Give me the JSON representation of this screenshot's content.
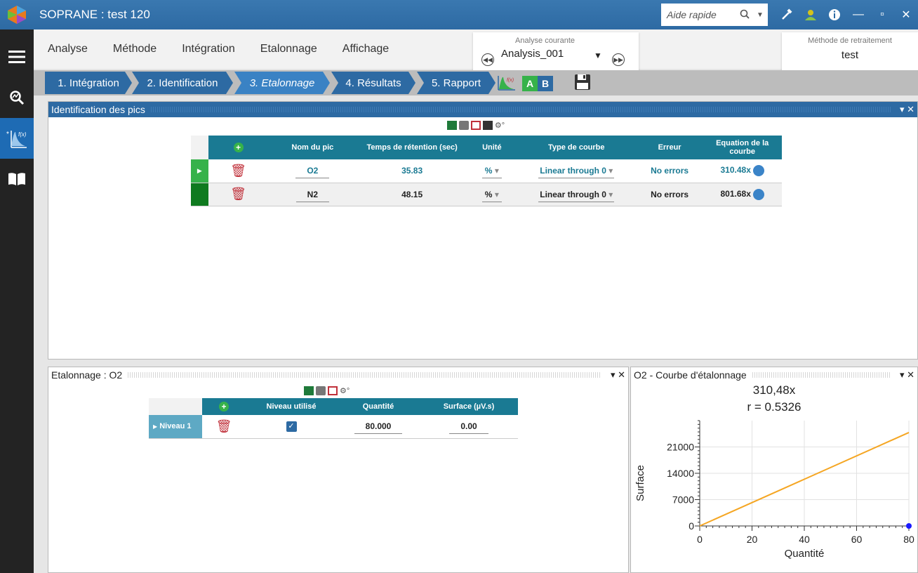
{
  "title_bar": {
    "app_title": "SOPRANE : test 120",
    "help_placeholder": "Aide rapide",
    "icons": [
      "search-icon",
      "hammer-icon",
      "user-icon",
      "info-icon",
      "minimize-icon",
      "maximize-icon",
      "close-icon"
    ]
  },
  "menu": {
    "items": [
      "Analyse",
      "Méthode",
      "Intégration",
      "Etalonnage",
      "Affichage"
    ]
  },
  "current_analysis": {
    "label": "Analyse courante",
    "value": "Analysis_001"
  },
  "method": {
    "label": "Méthode de retraitement",
    "value": "test"
  },
  "steps": [
    {
      "label": "1. Intégration"
    },
    {
      "label": "2. Identification"
    },
    {
      "label": "3. Etalonnage",
      "active": true
    },
    {
      "label": "4. Résultats"
    },
    {
      "label": "5. Rapport"
    }
  ],
  "ab": {
    "a": "A",
    "b": "B"
  },
  "peaks_panel": {
    "title": "Identification des pics",
    "columns": [
      "Nom du pic",
      "Temps de rétention (sec)",
      "Unité",
      "Type de courbe",
      "Erreur",
      "Equation de la courbe"
    ],
    "rows": [
      {
        "name": "O2",
        "retention": "35.83",
        "unit": "%",
        "curve": "Linear through 0",
        "error": "No errors",
        "equation": "310.48x"
      },
      {
        "name": "N2",
        "retention": "48.15",
        "unit": "%",
        "curve": "Linear through 0",
        "error": "No errors",
        "equation": "801.68x"
      }
    ],
    "colors": {
      "header": "#1a7a93",
      "row_selected_text": "#1a7a93",
      "row_marker_1": "#36b24a",
      "row_marker_2": "#0f7a1f"
    }
  },
  "calib_panel": {
    "title": "Etalonnage : O2",
    "columns": [
      "Niveau utilisé",
      "Quantité",
      "Surface  (µV.s)"
    ],
    "rows": [
      {
        "level": "Niveau 1",
        "used": true,
        "quantity": "80.000",
        "surface": "0.00"
      }
    ]
  },
  "curve_panel": {
    "title": "O2 - Courbe d'étalonnage"
  },
  "chart_data": {
    "type": "line",
    "title": "310,48x",
    "subtitle": "r = 0.5326",
    "xlabel": "Quantité",
    "ylabel": "Surface",
    "xlim": [
      0,
      80
    ],
    "ylim": [
      0,
      28000
    ],
    "x_ticks": [
      0,
      20,
      40,
      60,
      80
    ],
    "y_ticks": [
      0,
      7000,
      14000,
      21000
    ],
    "grid": true,
    "series": [
      {
        "type": "line",
        "x": [
          0,
          80
        ],
        "y": [
          0,
          24838
        ],
        "color": "#f5a623"
      },
      {
        "type": "scatter",
        "x": [
          80
        ],
        "y": [
          0
        ],
        "color": "#1a1aff"
      }
    ]
  }
}
